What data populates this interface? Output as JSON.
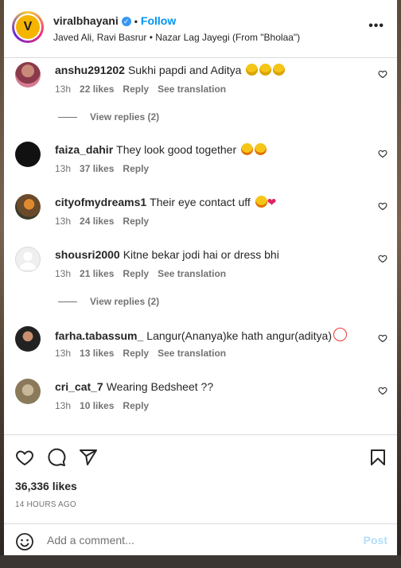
{
  "header": {
    "username": "viralbhayani",
    "separator": "•",
    "follow_label": "Follow",
    "subtitle": "Javed Ali, Ravi Basrur • Nazar Lag Jayegi (From \"Bholaa\")",
    "logo_letter": "V",
    "more_icon": "more-horizontal-icon"
  },
  "comments": [
    {
      "user": "anshu291202",
      "text": "Sukhi papdi and Aditya",
      "emojis": "laugh-x3",
      "time": "13h",
      "likes": "22 likes",
      "reply": "Reply",
      "translate": "See translation",
      "replies": "View replies (2)"
    },
    {
      "user": "faiza_dahir",
      "text": "They look good together",
      "emojis": "star-struck-x2",
      "time": "13h",
      "likes": "37 likes",
      "reply": "Reply"
    },
    {
      "user": "cityofmydreams1",
      "text": "Their eye contact uff",
      "emojis": "star-struck, red-heart",
      "time": "13h",
      "likes": "24 likes",
      "reply": "Reply"
    },
    {
      "user": "shousri2000",
      "text": "Kitne bekar jodi hai or dress bhi",
      "time": "13h",
      "likes": "21 likes",
      "reply": "Reply",
      "translate": "See translation",
      "replies": "View replies (2)"
    },
    {
      "user": "farha.tabassum_",
      "text": "Langur(Ananya)ke hath angur(aditya)",
      "emojis": "clown",
      "time": "13h",
      "likes": "13 likes",
      "reply": "Reply",
      "translate": "See translation"
    },
    {
      "user": "cri_cat_7",
      "text": "Wearing Bedsheet ??",
      "time": "13h",
      "likes": "10 likes",
      "reply": "Reply"
    }
  ],
  "actions": {
    "likes": "36,336 likes",
    "timestamp": "14 HOURS AGO",
    "icons": [
      "heart-icon",
      "comment-icon",
      "share-icon",
      "bookmark-icon"
    ]
  },
  "add_comment": {
    "placeholder": "Add a comment...",
    "post_label": "Post"
  },
  "colors": {
    "accent": "#0095f6",
    "post_disabled": "#b2dffc",
    "muted": "#737373"
  }
}
